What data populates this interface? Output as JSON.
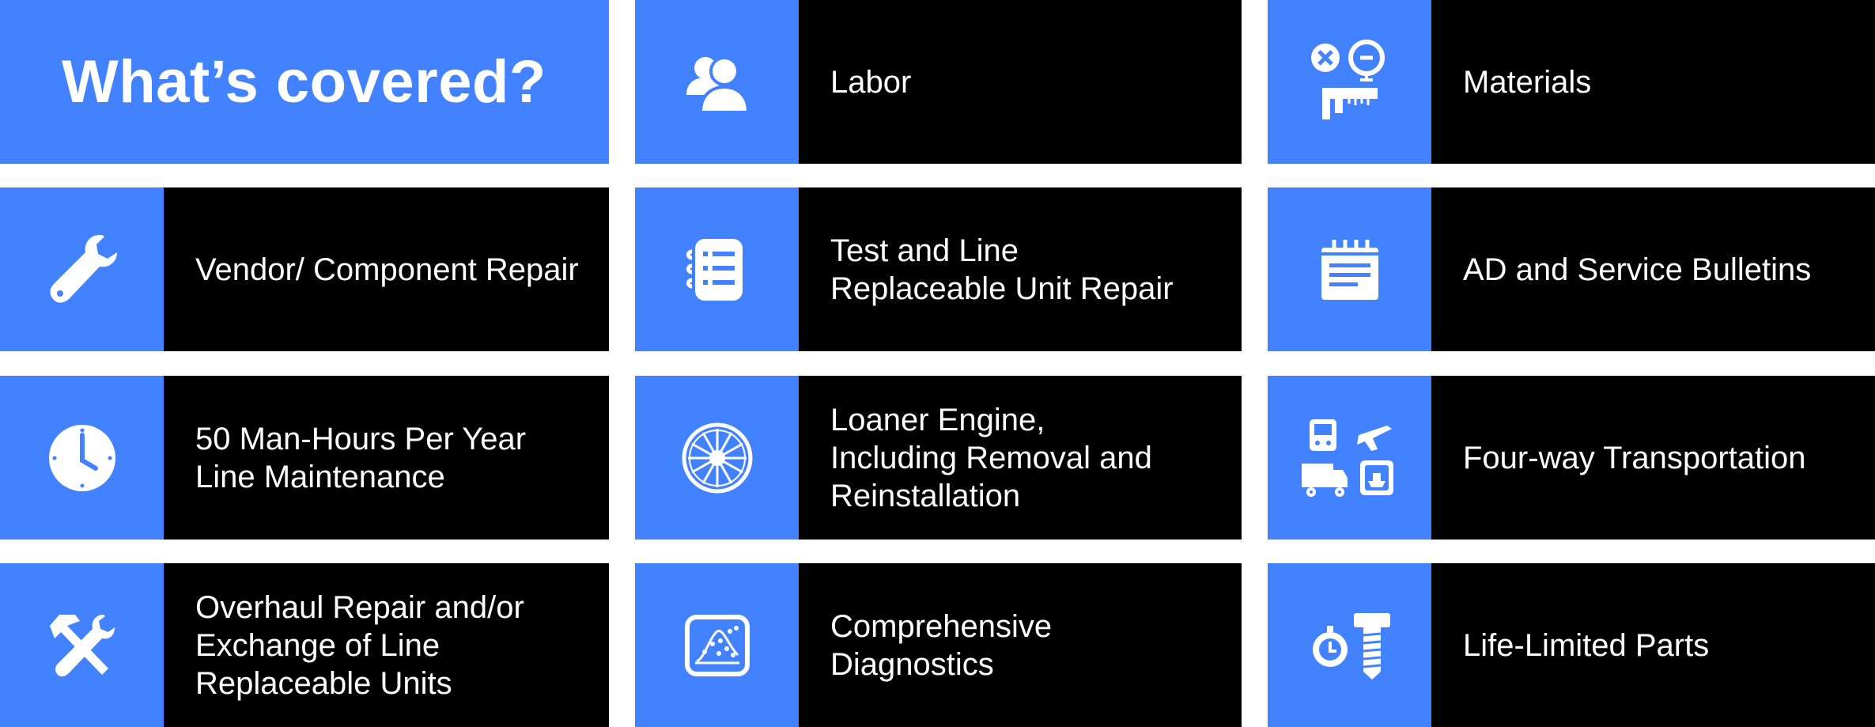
{
  "title": "What’s covered?",
  "colors": {
    "accent": "#4282FF",
    "tile_bg": "#000000",
    "text": "#FFFFFF"
  },
  "items": [
    {
      "icon": "people-icon",
      "lines": [
        "Labor"
      ]
    },
    {
      "icon": "measurement-icon",
      "lines": [
        "Materials"
      ]
    },
    {
      "icon": "wrench-icon",
      "lines": [
        "Vendor/ Component Repair"
      ]
    },
    {
      "icon": "checklist-icon",
      "lines": [
        "Test and Line",
        "Replaceable Unit Repair"
      ]
    },
    {
      "icon": "notepad-icon",
      "lines": [
        "AD and Service Bulletins"
      ]
    },
    {
      "icon": "clock-icon",
      "lines": [
        "50 Man-Hours Per Year",
        "Line Maintenance"
      ]
    },
    {
      "icon": "turbine-icon",
      "lines": [
        "Loaner Engine,",
        "Including Removal and",
        "Reinstallation"
      ]
    },
    {
      "icon": "transportation-icon",
      "lines": [
        "Four-way Transportation"
      ]
    },
    {
      "icon": "hammer-wrench-icon",
      "lines": [
        "Overhaul Repair and/or",
        "Exchange of Line",
        "Replaceable Units"
      ]
    },
    {
      "icon": "diagnostics-chart-icon",
      "lines": [
        "Comprehensive",
        "Diagnostics"
      ]
    },
    {
      "icon": "stopwatch-bolt-icon",
      "lines": [
        "Life-Limited Parts"
      ]
    }
  ]
}
